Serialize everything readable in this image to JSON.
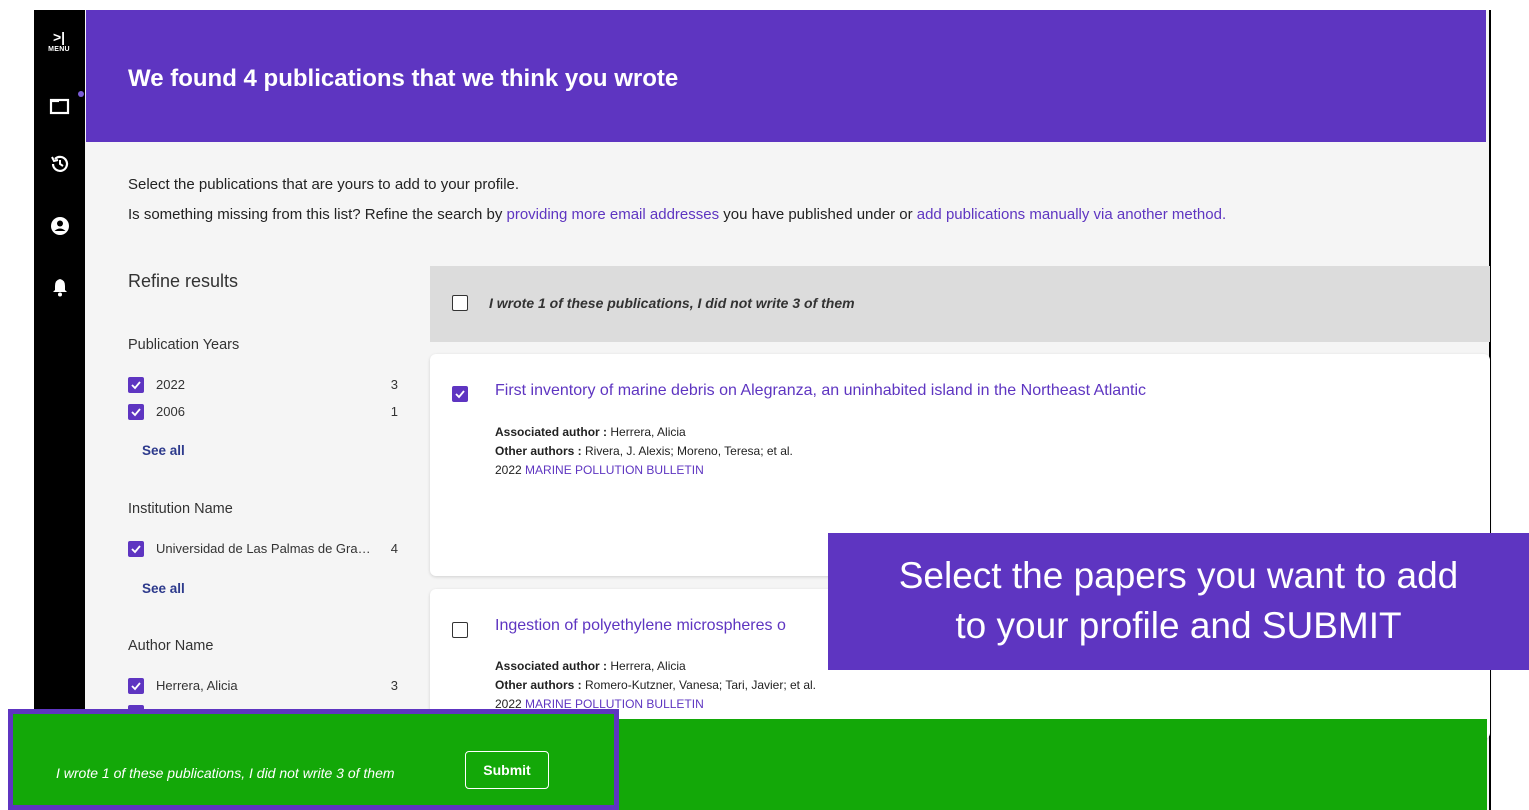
{
  "sidebar": {
    "toggle_glyph": ">|",
    "menu_label": "MENU",
    "icons": [
      "folder-icon",
      "history-icon",
      "account-icon",
      "bell-icon"
    ]
  },
  "banner": {
    "title": "We found 4 publications that we think you wrote"
  },
  "intro": {
    "line1": "Select the publications that are yours to add to your profile.",
    "line2_prefix": "Is something missing from this list? Refine the search by ",
    "link1": "providing more email addresses",
    "line2_middle": " you have published under or ",
    "link2": "add publications manually via another method."
  },
  "refine": {
    "title": "Refine results",
    "publication_years": {
      "title": "Publication Years",
      "items": [
        {
          "label": "2022",
          "count": "3",
          "checked": true
        },
        {
          "label": "2006",
          "count": "1",
          "checked": true
        }
      ],
      "see_all": "See all"
    },
    "institution_name": {
      "title": "Institution Name",
      "items": [
        {
          "label": "Universidad de Las Palmas de Gra…",
          "count": "4",
          "checked": true
        }
      ],
      "see_all": "See all"
    },
    "author_name": {
      "title": "Author Name",
      "items": [
        {
          "label": "Herrera, Alicia",
          "count": "3",
          "checked": true
        }
      ]
    }
  },
  "list": {
    "header_text": "I wrote 1 of these publications, I did not write 3 of them",
    "publications": [
      {
        "title": "First inventory of marine debris on Alegranza, an uninhabited island in the Northeast Atlantic",
        "associated_label": "Associated author : ",
        "associated_author": "Herrera, Alicia",
        "other_label": "Other authors : ",
        "other_authors": "Rivera, J. Alexis; Moreno, Teresa; et al.",
        "year": "2022",
        "journal": "MARINE POLLUTION BULLETIN",
        "checked": true
      },
      {
        "title": "Ingestion of polyethylene microspheres o",
        "associated_label": "Associated author : ",
        "associated_author": "Herrera, Alicia",
        "other_label": "Other authors : ",
        "other_authors": "Romero-Kutzner, Vanesa; Tari, Javier; et al.",
        "year": "2022",
        "journal": "MARINE POLLUTION BULLETIN",
        "checked": false
      }
    ]
  },
  "callout": {
    "line1": "Select the papers you want to add",
    "line2": "to your profile and SUBMIT"
  },
  "footer": {
    "summary": "I wrote 1 of these publications, I did not write 3 of them",
    "submit_label": "Submit"
  },
  "colors": {
    "accent": "#5e35c1",
    "footer_green": "#13a808",
    "sidebar": "#000000"
  }
}
